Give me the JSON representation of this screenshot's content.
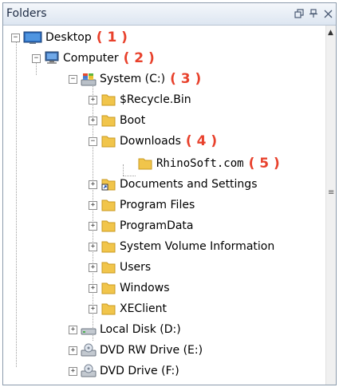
{
  "panel": {
    "title": "Folders",
    "buttons": {
      "float": "⧉",
      "pin": "ᵽ",
      "close": "×"
    }
  },
  "tree": [
    {
      "label": "Desktop",
      "annotation": "( 1 )",
      "icon": "desktop-icon",
      "expander": "−"
    },
    {
      "label": "Computer",
      "annotation": "( 2 )",
      "icon": "computer-icon",
      "expander": "−"
    },
    {
      "label": "System (C:)",
      "annotation": "( 3 )",
      "icon": "system-drive-icon",
      "expander": "−"
    },
    {
      "label": "$Recycle.Bin",
      "icon": "folder-icon",
      "expander": "+"
    },
    {
      "label": "Boot",
      "icon": "folder-icon",
      "expander": "+"
    },
    {
      "label": "Downloads",
      "annotation": "( 4 )",
      "icon": "folder-icon",
      "expander": "−"
    },
    {
      "label": "RhinoSoft.com",
      "annotation": "( 5 )",
      "icon": "folder-icon"
    },
    {
      "label": "Documents and Settings",
      "icon": "shortcut-folder-icon",
      "expander": "+"
    },
    {
      "label": "Program Files",
      "icon": "folder-icon",
      "expander": "+"
    },
    {
      "label": "ProgramData",
      "icon": "folder-icon",
      "expander": "+"
    },
    {
      "label": "System Volume Information",
      "icon": "folder-icon",
      "expander": "+"
    },
    {
      "label": "Users",
      "icon": "folder-icon",
      "expander": "+"
    },
    {
      "label": "Windows",
      "icon": "folder-icon",
      "expander": "+"
    },
    {
      "label": "XEClient",
      "icon": "folder-icon",
      "expander": "+"
    },
    {
      "label": "Local Disk (D:)",
      "icon": "hard-disk-icon",
      "expander": "+"
    },
    {
      "label": "DVD RW Drive (E:)",
      "icon": "dvd-drive-icon",
      "expander": "+"
    },
    {
      "label": "DVD Drive (F:)",
      "icon": "dvd-drive-icon",
      "expander": "+"
    }
  ],
  "colors": {
    "annotation": "#e8412c",
    "folder": "#f1c54b",
    "titlebar": "#dde6f1"
  }
}
